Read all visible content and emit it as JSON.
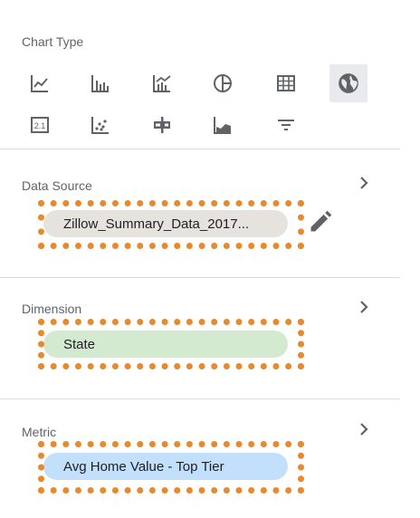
{
  "chart_type": {
    "label": "Chart Type",
    "icons": [
      "time-series-chart-icon",
      "bar-chart-icon",
      "combo-chart-icon",
      "pie-chart-icon",
      "table-icon",
      "geo-map-icon",
      "scorecard-icon",
      "scatter-chart-icon",
      "bullet-chart-icon",
      "area-chart-icon",
      "filter-control-icon"
    ],
    "scorecard_text": "2.1",
    "selected": "geo-map-icon"
  },
  "data_source": {
    "label": "Data Source",
    "value": "Zillow_Summary_Data_2017..."
  },
  "dimension": {
    "label": "Dimension",
    "value": "State"
  },
  "metric": {
    "label": "Metric",
    "value": "Avg Home Value - Top Tier"
  },
  "colors": {
    "highlight": "#e7892d",
    "data_source_chip": "#e6e3df",
    "dimension_chip": "#d3e9d0",
    "metric_chip": "#c2dffb",
    "icon": "#5f6368"
  }
}
